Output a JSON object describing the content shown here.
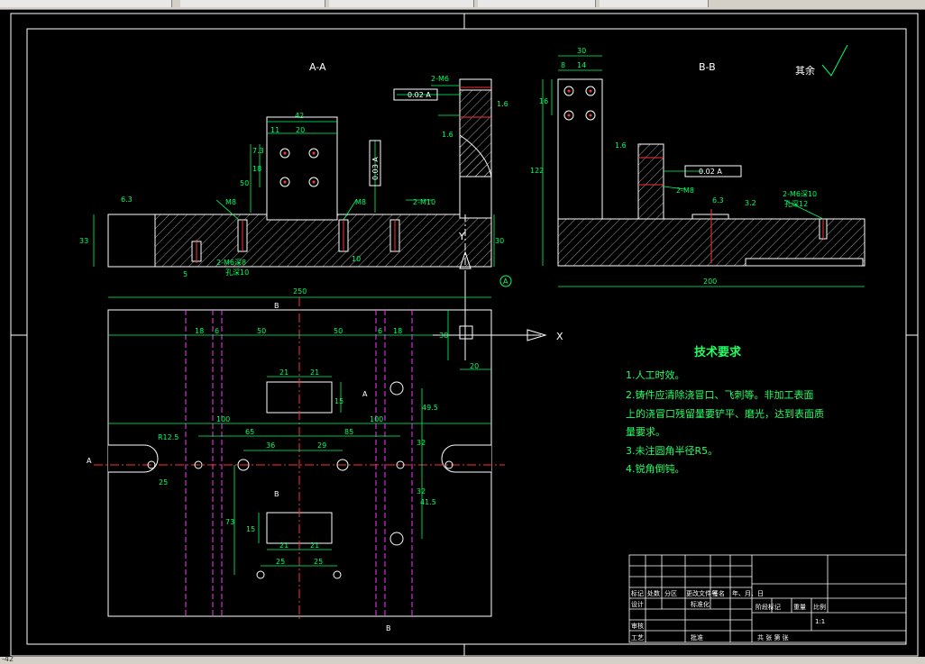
{
  "statusbar": {
    "coords": "-42"
  },
  "drawing": {
    "view_aa_title": "A-A",
    "view_bb_title": "B-B",
    "roughness_note": "其余",
    "tech_title": "技术要求",
    "tech_items": [
      "1.人工时效。",
      "2.铸件应清除浇冒口、飞刺等。非加工表面",
      "上的浇冒口残留量要铲平、磨光，达到表面质",
      "量要求。",
      "3.未注圆角半径R5。",
      "4.锐角倒钝。"
    ],
    "labels": {
      "m6_top": "2-M6",
      "m8_a": "M8",
      "m8_b": "M8",
      "m10": "2-M10",
      "m6_b_pitch": "2-M6深8",
      "holeD": "孔深10",
      "m8_bb": "2-M8",
      "m6_bb": "2-M6深10",
      "holeD12": "孔深12",
      "x_axis": "X",
      "y_axis": "Y",
      "sec_A": "A",
      "sec_B": "B"
    },
    "tolerances": {
      "perp1": "0.02 A",
      "par1": "0.03 A",
      "perp2": "0.02 A"
    },
    "roughness": {
      "r63a": "6.3",
      "r16a": "1.6",
      "r16b": "1.6",
      "r16c": "1.6",
      "r63b": "6.3",
      "r32": "3.2"
    },
    "dims": {
      "d42": "42",
      "d11": "11",
      "d20": "20",
      "d73": "7.3",
      "d18": "18",
      "d50": "50",
      "d33": "33",
      "d5": "5",
      "d10": "10",
      "d30": "30",
      "d30b": "30",
      "d8": "8",
      "d14": "14",
      "d16": "16",
      "d122": "122",
      "d200": "200",
      "d250": "250",
      "d18a": "18",
      "d6a": "6",
      "d50a": "50",
      "d50b": "50",
      "d6b": "6",
      "d18b": "18",
      "d30c": "30",
      "d21a": "21",
      "d21b": "21",
      "d15a": "15",
      "d49": "49.5",
      "d100a": "100",
      "d100b": "100",
      "d65": "65",
      "d85": "85",
      "d36": "36",
      "d29": "29",
      "d32a": "32",
      "d32b": "32",
      "dR125": "R12.5",
      "d25": "25",
      "d73b": "73",
      "d15b": "15",
      "d21c": "21",
      "d21d": "21",
      "d25a": "25",
      "d25b": "25",
      "d415": "41.5"
    },
    "title_block": {
      "row1": [
        "标记",
        "处数",
        "分区",
        "更改文件号",
        "签名",
        "年、月、日"
      ],
      "design": "设计",
      "std": "标准化",
      "review": "审核",
      "process": "工艺",
      "approve": "批准",
      "stage": "阶段标记",
      "weight": "重量",
      "scale": "比例",
      "scale_val": "1:1",
      "sheets": "共  张  第  张"
    }
  }
}
